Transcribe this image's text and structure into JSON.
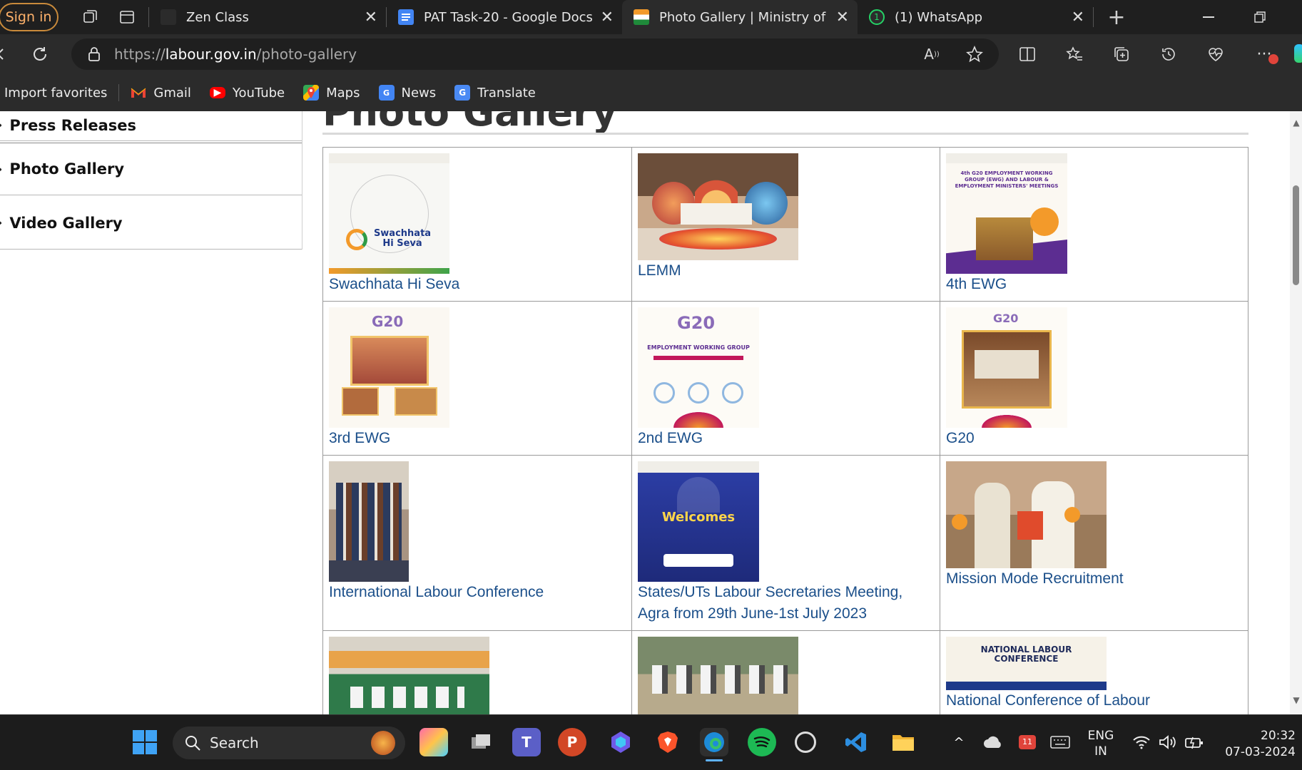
{
  "browser": {
    "signin_label": "Sign in",
    "tabs": [
      {
        "title": "Zen Class",
        "close": "✕"
      },
      {
        "title": "PAT Task-20 - Google Docs",
        "close": "✕"
      },
      {
        "title": "Photo Gallery | Ministry of Lal",
        "close": "✕"
      },
      {
        "title": "(1) WhatsApp",
        "close": "✕"
      }
    ],
    "new_tab": "+",
    "url_prefix": "https://",
    "url_domain": "labour.gov.in",
    "url_path": "/photo-gallery",
    "whatsapp_badge": "1"
  },
  "bookmarks": [
    {
      "label": "Import favorites"
    },
    {
      "label": "Gmail"
    },
    {
      "label": "YouTube"
    },
    {
      "label": "Maps"
    },
    {
      "label": "News"
    },
    {
      "label": "Translate"
    }
  ],
  "sidebar": {
    "items": [
      {
        "label": "Press Releases"
      },
      {
        "label": "Photo Gallery"
      },
      {
        "label": "Video Gallery"
      }
    ]
  },
  "page": {
    "heading": "Photo Gallery"
  },
  "gallery": [
    {
      "caption": "Swachhata Hi Seva",
      "thumb_text": "Swachhata Hi Seva"
    },
    {
      "caption": "LEMM",
      "thumb_text": ""
    },
    {
      "caption": "4th EWG",
      "thumb_text": "4th G20 EMPLOYMENT WORKING GROUP (EWG) AND LABOUR & EMPLOYMENT MINISTERS' MEETINGS"
    },
    {
      "caption": "3rd EWG",
      "thumb_text": "G20"
    },
    {
      "caption": "2nd EWG",
      "thumb_text": "EMPLOYMENT WORKING GROUP"
    },
    {
      "caption": "G20",
      "thumb_text": "G20"
    },
    {
      "caption": "International Labour Conference",
      "thumb_text": ""
    },
    {
      "caption": "States/UTs Labour Secretaries Meeting, Agra from 29th June-1st July 2023",
      "thumb_text": "Welcomes"
    },
    {
      "caption": "Mission Mode Recruitment",
      "thumb_text": ""
    },
    {
      "caption": "",
      "thumb_text": ""
    },
    {
      "caption": "",
      "thumb_text": ""
    },
    {
      "caption": "National Conference of Labour",
      "thumb_text": "NATIONAL LABOUR CONFERENCE"
    }
  ],
  "taskbar": {
    "search_label": "Search",
    "lang_top": "ENG",
    "lang_bottom": "IN",
    "time": "20:32",
    "date": "07-03-2024",
    "badge": "11"
  },
  "colors": {
    "link": "#1b4f8a",
    "accent_orange": "#ffb26b",
    "g20_purple": "#5c2d91",
    "agra_blue": "#2d3fa8"
  }
}
